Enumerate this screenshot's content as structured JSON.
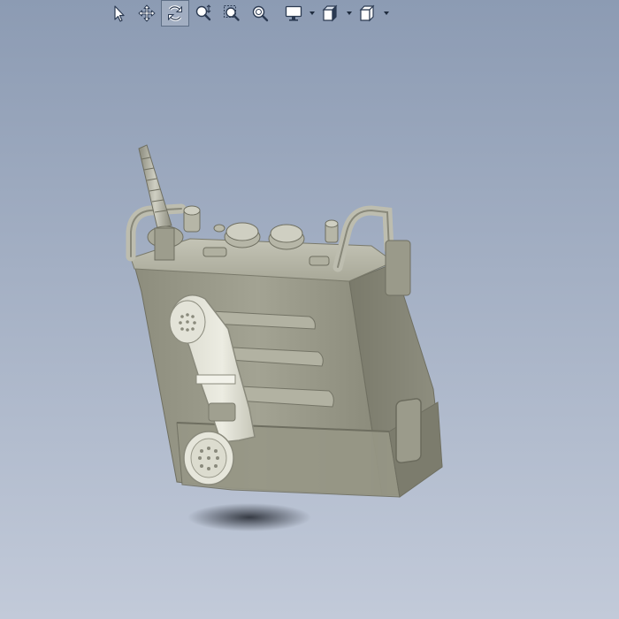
{
  "viewer": {
    "background_top": "#8c9bb3",
    "background_bottom": "#c2cad9",
    "model_color": "#9c9c8c"
  },
  "toolbar": {
    "tools": [
      {
        "name": "select-tool",
        "icon": "arrow-cursor-icon",
        "active": false,
        "dropdown": false
      },
      {
        "name": "pan-tool",
        "icon": "pan-move-icon",
        "active": false,
        "dropdown": false
      },
      {
        "name": "rotate-tool",
        "icon": "rotate-icon",
        "active": true,
        "dropdown": false
      },
      {
        "name": "zoom-tool",
        "icon": "zoom-icon",
        "active": false,
        "dropdown": false
      },
      {
        "name": "zoom-window-tool",
        "icon": "zoom-window-icon",
        "active": false,
        "dropdown": false
      },
      {
        "name": "zoom-fit-tool",
        "icon": "zoom-fit-icon",
        "active": false,
        "dropdown": false
      },
      {
        "name": "display-mode-tool",
        "icon": "monitor-icon",
        "active": false,
        "dropdown": true
      },
      {
        "name": "standard-views-tool",
        "icon": "views-icon",
        "active": false,
        "dropdown": true
      },
      {
        "name": "view-orientation-tool",
        "icon": "cube-icon",
        "active": false,
        "dropdown": true
      }
    ]
  },
  "model": {
    "name": "field-radio-with-handset-icon"
  }
}
